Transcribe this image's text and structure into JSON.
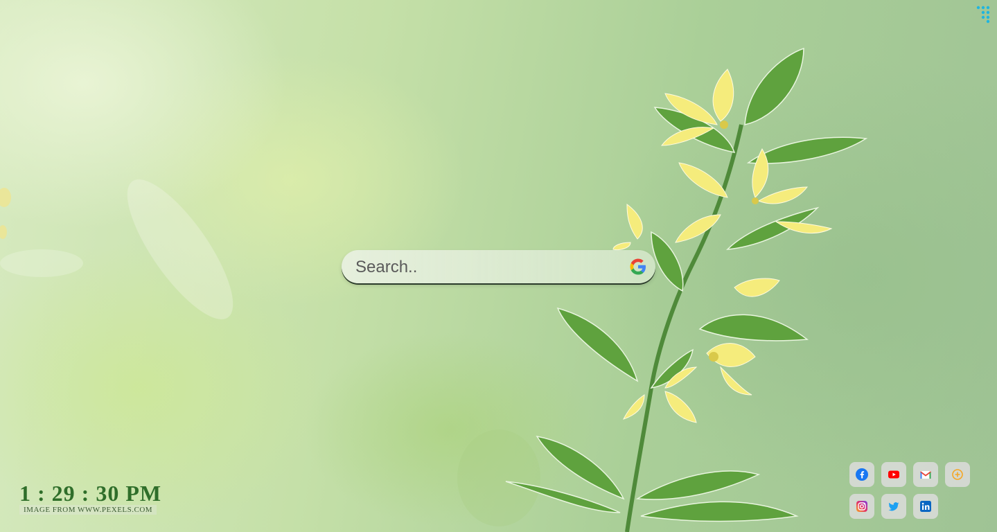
{
  "search": {
    "placeholder": "Search.."
  },
  "clock": {
    "time": "1 : 29 : 30 PM"
  },
  "credit": {
    "text": "IMAGE FROM WWW.PEXELS.COM"
  },
  "icons": {
    "menu": "dots-grid-icon",
    "search_engine": "google-icon",
    "social": [
      "facebook-icon",
      "youtube-icon",
      "gmail-icon",
      "add-icon",
      "instagram-icon",
      "twitter-icon",
      "linkedin-icon"
    ]
  },
  "colors": {
    "clock": "#2f6e2a",
    "menu_dots": "#1fb5e0"
  }
}
